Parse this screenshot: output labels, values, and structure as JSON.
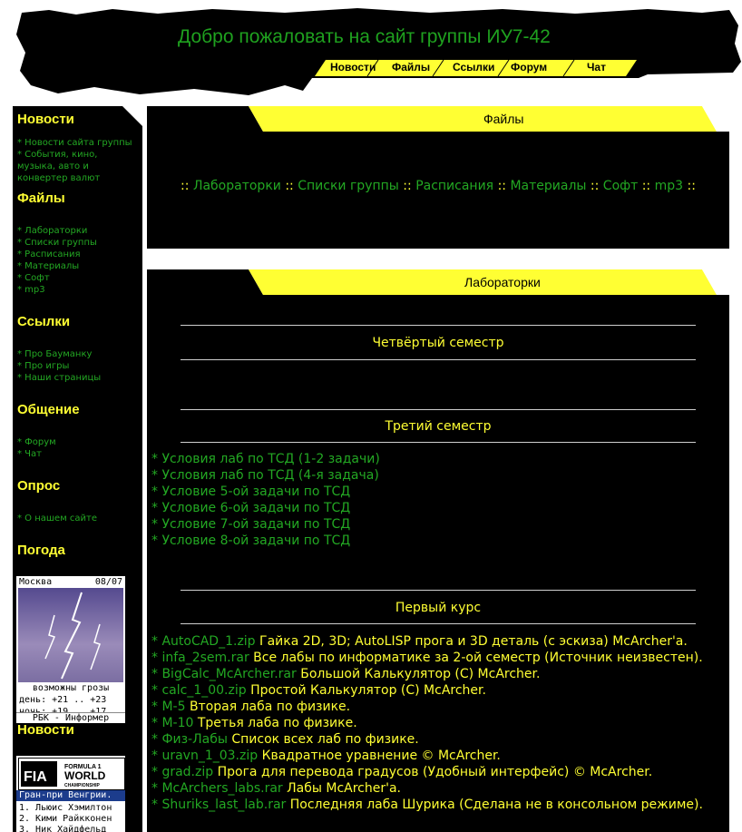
{
  "header": {
    "title": "Добро пожаловать на сайт группы ИУ7-42",
    "nav": [
      "Новости",
      "Файлы",
      "Ссылки",
      "Форум",
      "Чат"
    ]
  },
  "sidebar": {
    "news_heading": "Новости",
    "news_links": [
      "* Новости сайта группы"
    ],
    "news_events": "* События, кино, музыка, авто и конвертер валют",
    "files_heading": "Файлы",
    "files_links": [
      "* Лабораторки",
      "* Списки группы",
      "* Расписания",
      "* Материалы",
      "* Софт",
      "* mp3"
    ],
    "links_heading": "Ссылки",
    "links_links": [
      "* Про Бауманку",
      "* Про игры",
      "* Наши страницы"
    ],
    "talk_heading": "Общение",
    "talk_links": [
      "* Форум",
      "* Чат"
    ],
    "poll_heading": "Опрос",
    "poll_links": [
      "* О нашем сайте"
    ],
    "weather_heading": "Погода",
    "weather": {
      "city": "Москва",
      "date": "08/07",
      "condition": "возможны грозы",
      "day": "день:  +21 .. +23",
      "night": "ночь:  +19 .. +17",
      "source": "РБК - Информер"
    },
    "news2_heading": "Новости",
    "f1": {
      "logo_text": "FORMULA 1 WORLD CHAMPIONSHIP",
      "bar": "Гран-при Венгрии. ...",
      "rows": [
        "1. Льюис Хэмилтон",
        "2. Кими Райкконен",
        "3. Ник Хайдфельд"
      ]
    }
  },
  "files_panel": {
    "title": "Файлы",
    "links": [
      "Лабораторки",
      "Списки группы",
      "Расписания",
      "Материалы",
      "Софт",
      "mp3"
    ],
    "sep": "::"
  },
  "labs_panel": {
    "title": "Лабораторки",
    "sem4": "Четвёртый семестр",
    "sem3": "Третий семестр",
    "sem3_items": [
      "* Условия лаб по ТСД (1-2 задачи)",
      "* Условия лаб по ТСД (4-я задача)",
      "* Условие 5-ой задачи по ТСД",
      "* Условие 6-ой задачи по ТСД",
      "* Условие 7-ой задачи по ТСД",
      "* Условие 8-ой задачи по ТСД"
    ],
    "course1": "Первый курс",
    "course1_items": [
      {
        "link": "* AutoCAD_1.zip",
        "desc": " Гайка 2D, 3D; AutoLISP прога и 3D деталь (с эскиза) McArcher'a."
      },
      {
        "link": "* infa_2sem.rar",
        "desc": " Все лабы по информатике за 2-ой семестр (Источник неизвестен)."
      },
      {
        "link": "* BigCalc_McArcher.rar",
        "desc": " Большой Калькулятор (С) McArcher."
      },
      {
        "link": "* calc_1_00.zip",
        "desc": " Простой Калькулятор (С) McArcher."
      },
      {
        "link": "* М-5",
        "desc": " Вторая лаба по физике."
      },
      {
        "link": "* М-10",
        "desc": " Третья лаба по физике."
      },
      {
        "link": "* Физ-Лабы",
        "desc": " Список всех лаб по физике."
      },
      {
        "link": "* uravn_1_03.zip",
        "desc": " Квадратное уравнение © McArcher."
      },
      {
        "link": "* grad.zip",
        "desc": " Прога для перевода градусов (Удобный интерфейс) © McArcher."
      },
      {
        "link": "* McArchers_labs.rar",
        "desc": " Лабы McArcher'a."
      },
      {
        "link": "* Shuriks_last_lab.rar",
        "desc": " Последняя лаба Шурика (Сделана не в консольном режиме)."
      }
    ]
  },
  "colors": {
    "accent_yellow": "#ffff33",
    "link_green": "#23a823",
    "background": "#000000"
  }
}
